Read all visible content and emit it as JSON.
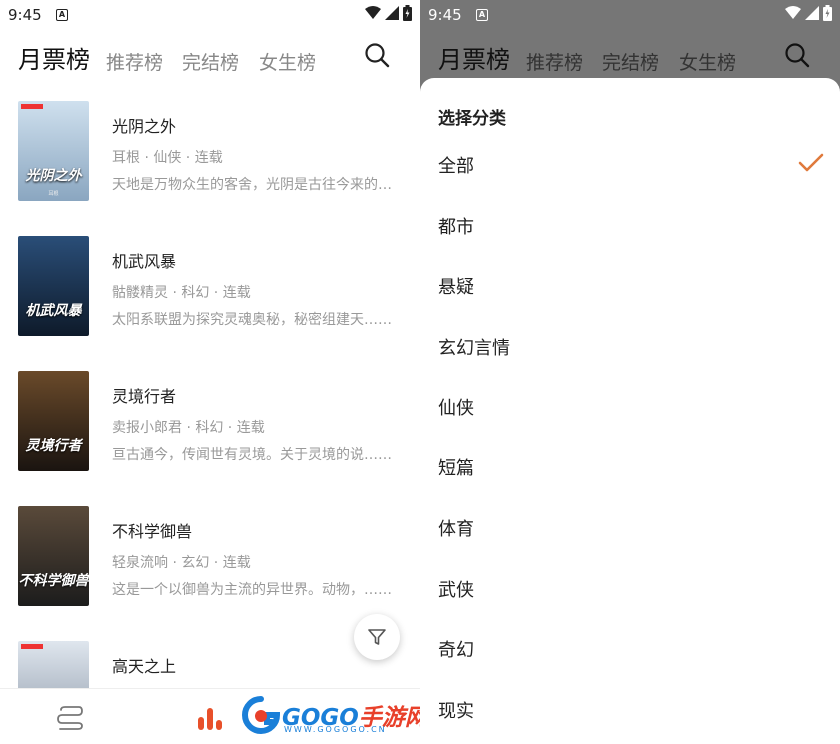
{
  "status": {
    "time": "9:45",
    "notif": "A"
  },
  "tabs": {
    "main": "月票榜",
    "t1": "推荐榜",
    "t2": "完结榜",
    "t3": "女生榜"
  },
  "books": [
    {
      "title": "光阴之外",
      "meta": "耳根 · 仙侠 · 连载",
      "desc": "天地是万物众生的客舍，光阴是古往今来的过客……",
      "cover_text": "光阴之外",
      "cover_author": "耳根",
      "colors": [
        "#cfe0ee",
        "#8aa6c0"
      ]
    },
    {
      "title": "机武风暴",
      "meta": "骷髅精灵 · 科幻 · 连载",
      "desc": "太阳系联盟为探究灵魂奥秘，秘密组建天……",
      "cover_text": "机武风暴",
      "cover_author": "",
      "colors": [
        "#2a4e78",
        "#0e1a2a"
      ]
    },
    {
      "title": "灵境行者",
      "meta": "卖报小郎君 · 科幻 · 连载",
      "desc": "亘古通今，传闻世有灵境。关于灵境的说……",
      "cover_text": "灵境行者",
      "cover_author": "",
      "colors": [
        "#6a4a2a",
        "#1a1410"
      ]
    },
    {
      "title": "不科学御兽",
      "meta": "轻泉流响 · 玄幻 · 连载",
      "desc": "这是一个以御兽为主流的异世界。动物，……",
      "cover_text": "不科学御兽",
      "cover_author": "",
      "colors": [
        "#5a4a3a",
        "#1c1c1c"
      ]
    },
    {
      "title": "高天之上",
      "meta": "",
      "desc": "",
      "cover_text": "",
      "cover_author": "",
      "colors": [
        "#dfe6ee",
        "#8a96a6"
      ]
    }
  ],
  "watermark": {
    "brand": "GOGO",
    "brand_suffix": "手游网",
    "url": "WWW.GOGOGO.CN"
  },
  "sheet": {
    "title": "选择分类",
    "categories": [
      {
        "label": "全部",
        "selected": true
      },
      {
        "label": "都市",
        "selected": false
      },
      {
        "label": "悬疑",
        "selected": false
      },
      {
        "label": "玄幻言情",
        "selected": false
      },
      {
        "label": "仙侠",
        "selected": false
      },
      {
        "label": "短篇",
        "selected": false
      },
      {
        "label": "体育",
        "selected": false
      },
      {
        "label": "武侠",
        "selected": false
      },
      {
        "label": "奇幻",
        "selected": false
      },
      {
        "label": "现实",
        "selected": false
      }
    ],
    "check_color": "#e07a3c"
  }
}
